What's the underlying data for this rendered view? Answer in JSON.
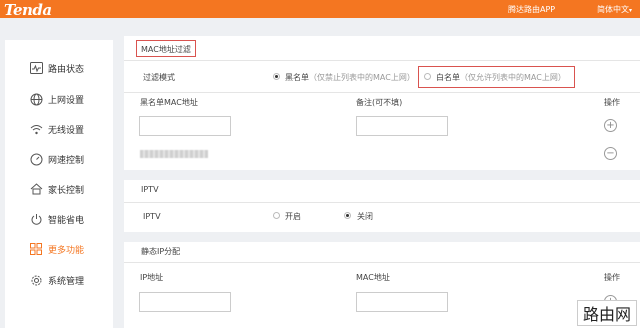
{
  "header": {
    "logo": "Tenda",
    "app_link": "腾达路由APP",
    "language": "简体中文"
  },
  "sidebar": {
    "items": [
      {
        "label": "路由状态",
        "icon": "status-icon"
      },
      {
        "label": "上网设置",
        "icon": "globe-icon"
      },
      {
        "label": "无线设置",
        "icon": "wifi-icon"
      },
      {
        "label": "网速控制",
        "icon": "speed-icon"
      },
      {
        "label": "家长控制",
        "icon": "home-icon"
      },
      {
        "label": "智能省电",
        "icon": "power-icon"
      },
      {
        "label": "更多功能",
        "icon": "grid-icon",
        "active": true
      },
      {
        "label": "系统管理",
        "icon": "settings-icon"
      }
    ]
  },
  "mac_filter": {
    "title": "MAC地址过滤",
    "mode_label": "过滤模式",
    "blacklist_label": "黑名单",
    "blacklist_hint": "（仅禁止列表中的MAC上网）",
    "whitelist_label": "白名单",
    "whitelist_hint": "（仅允许列表中的MAC上网）",
    "selected": "blacklist",
    "col_mac": "黑名单MAC地址",
    "col_remark": "备注(可不填)",
    "col_action": "操作"
  },
  "iptv": {
    "section_title": "IPTV",
    "label": "IPTV",
    "on_label": "开启",
    "off_label": "关闭",
    "selected": "off"
  },
  "static_ip": {
    "section_title": "静态IP分配",
    "col_ip": "IP地址",
    "col_mac": "MAC地址",
    "col_action": "操作"
  },
  "watermark": "路由网",
  "colors": {
    "brand": "#f47621",
    "highlight": "#d9534f"
  }
}
